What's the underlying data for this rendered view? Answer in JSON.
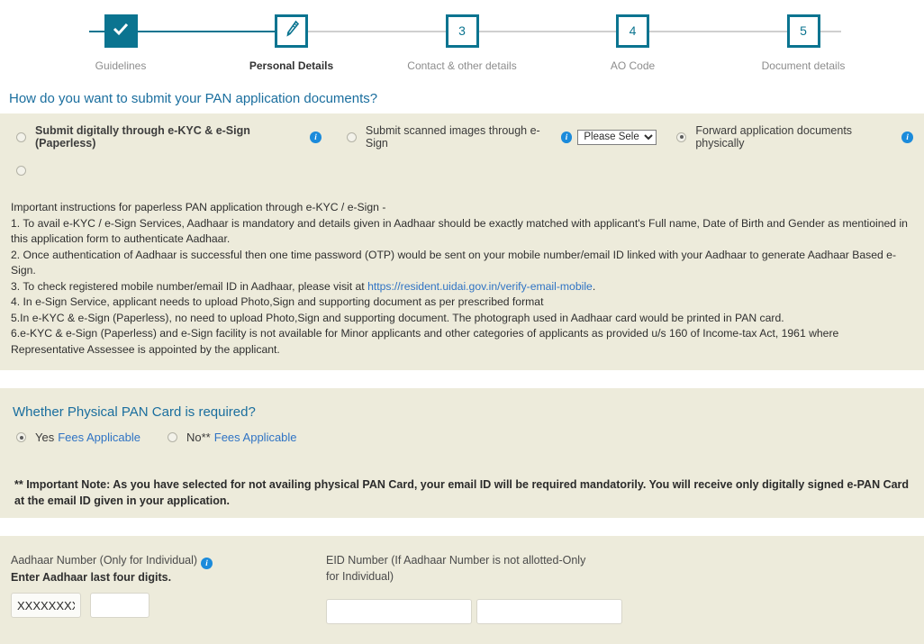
{
  "colors": {
    "teal": "#0b7490",
    "panel_bg": "#edebdb",
    "heading_blue": "#1a6e9e",
    "link_blue": "#2f73c4",
    "info_blue": "#1b8bdb"
  },
  "stepper": {
    "steps": [
      {
        "marker": "check-icon",
        "label": "Guidelines",
        "state": "completed"
      },
      {
        "marker": "pen-icon",
        "label": "Personal Details",
        "state": "active"
      },
      {
        "marker": "3",
        "label": "Contact & other details",
        "state": "upcoming"
      },
      {
        "marker": "4",
        "label": "AO Code",
        "state": "upcoming"
      },
      {
        "marker": "5",
        "label": "Document details",
        "state": "upcoming"
      }
    ]
  },
  "submit_section": {
    "heading": "How do you want to submit your PAN application documents?",
    "options": [
      {
        "label": "Submit digitally through e-KYC & e-Sign (Paperless)",
        "checked": false,
        "bold": true,
        "info": true
      },
      {
        "label": "Submit scanned images through e-Sign",
        "checked": false,
        "bold": false,
        "info": true
      },
      {
        "label": "Forward application documents physically",
        "checked": true,
        "bold": false,
        "info": true
      }
    ],
    "esign_select": {
      "value": "Please Selec",
      "options": [
        "Please Select"
      ]
    },
    "instructions_title": "Important instructions for paperless PAN application through e-KYC / e-Sign -",
    "instructions": [
      "1. To avail e-KYC / e-Sign Services, Aadhaar is mandatory and details given in Aadhaar should be exactly matched with applicant's Full name, Date of Birth and Gender as mentioined in this application form to authenticate Aadhaar.",
      "2. Once authentication of Aadhaar is successful then one time password (OTP) would be sent on your mobile number/email ID linked with your Aadhaar to generate Aadhaar Based e-Sign.",
      "4. In e-Sign Service, applicant needs to upload Photo,Sign and supporting document as per prescribed format",
      "5.In e-KYC & e-Sign (Paperless), no need to upload Photo,Sign and supporting document. The photograph used in Aadhaar card would be printed in PAN card.",
      "6.e-KYC & e-Sign (Paperless) and e-Sign facility is not available for Minor applicants and other categories of applicants as provided u/s 160 of Income-tax Act, 1961 where Representative Assessee is appointed by the applicant."
    ],
    "instruction_3_pre": "3. To check registered mobile number/email ID in Aadhaar, please visit at ",
    "instruction_3_link": "https://resident.uidai.gov.in/verify-email-mobile",
    "instruction_3_post": "."
  },
  "physical_card_section": {
    "heading": "Whether Physical PAN Card is required?",
    "yes": {
      "text": "Yes",
      "link": "Fees Applicable",
      "checked": true
    },
    "no": {
      "text": "No**",
      "link": "Fees Applicable",
      "checked": false
    },
    "note": "** Important Note: As you have selected for not availing physical PAN Card, your email ID will be required mandatorily. You will receive only digitally signed e-PAN Card at the email ID given in your application."
  },
  "aadhaar_section": {
    "aadhaar_label": "Aadhaar Number (Only for Individual)",
    "aadhaar_sublabel": "Enter Aadhaar last four digits.",
    "aadhaar_masked_value": "XXXXXXXX",
    "aadhaar_last4_value": "",
    "eid_label": "EID Number (If Aadhaar Number is not allotted-Only for Individual)",
    "eid_value_1": "",
    "eid_value_2": ""
  }
}
